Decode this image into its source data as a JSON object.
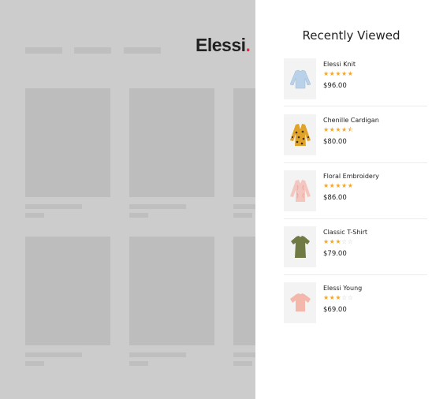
{
  "brand": {
    "name": "Elessi",
    "dot": "."
  },
  "drawer": {
    "title": "Recently Viewed"
  },
  "products": [
    {
      "name": "Elessi Knit",
      "rating": 5,
      "price": "$96.00",
      "icon": "sweater-icon",
      "color": "#b9d2ea"
    },
    {
      "name": "Chenille Cardigan",
      "rating": 4.5,
      "price": "$80.00",
      "icon": "cardigan-icon",
      "color": "#e0a42a"
    },
    {
      "name": "Floral Embroidery",
      "rating": 5,
      "price": "$86.00",
      "icon": "jacket-icon",
      "color": "#f4c6c0"
    },
    {
      "name": "Classic T-Shirt",
      "rating": 3,
      "price": "$79.00",
      "icon": "tshirt-icon",
      "color": "#6f7a45"
    },
    {
      "name": "Elessi Young",
      "rating": 3,
      "price": "$69.00",
      "icon": "top-icon",
      "color": "#f3b8ab"
    }
  ]
}
